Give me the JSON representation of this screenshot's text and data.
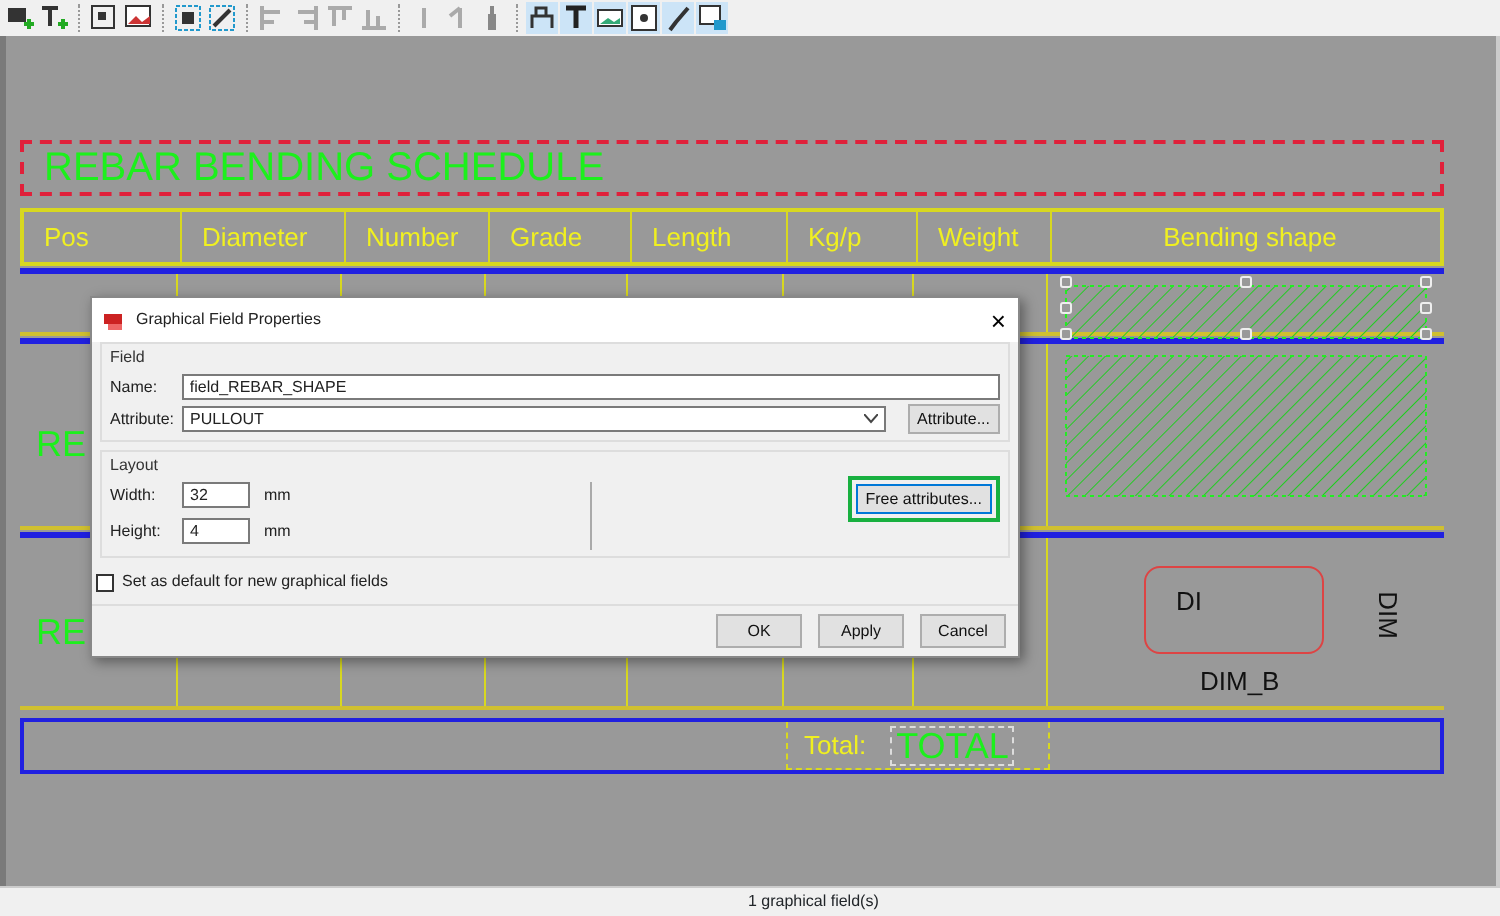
{
  "toolbar": {
    "buttons": [
      {
        "kind": "rect-field",
        "selected": false
      },
      {
        "kind": "text-field",
        "selected": false
      },
      {
        "kind": "frame",
        "selected": false
      },
      {
        "kind": "picture-frame",
        "selected": false
      },
      {
        "kind": "group",
        "selected": false
      },
      {
        "kind": "ungroup",
        "selected": false
      },
      {
        "kind": "align-left",
        "selected": false
      },
      {
        "kind": "align-right",
        "selected": false
      },
      {
        "kind": "align-top",
        "selected": false
      },
      {
        "kind": "align-bottom",
        "selected": false
      },
      {
        "kind": "line",
        "selected": false
      },
      {
        "kind": "angle",
        "selected": false
      },
      {
        "kind": "bottle",
        "selected": false
      },
      {
        "kind": "field",
        "selected": true
      },
      {
        "kind": "text",
        "selected": true
      },
      {
        "kind": "image",
        "selected": true
      },
      {
        "kind": "symbol",
        "selected": true
      },
      {
        "kind": "brush",
        "selected": true
      },
      {
        "kind": "window",
        "selected": true
      }
    ]
  },
  "schedule": {
    "title": "REBAR BENDING SCHEDULE",
    "columns": [
      "Pos",
      "Diameter",
      "Number",
      "Grade",
      "Length",
      "Kg/p",
      "Weight",
      "Bending shape"
    ],
    "rows": [
      {
        "kind": "hatched",
        "first_cell": "",
        "selected": true
      },
      {
        "kind": "hatched",
        "first_cell": "RE",
        "selected": false
      },
      {
        "kind": "dimension",
        "first_cell": "RE",
        "selected": false,
        "labels": [
          "DI",
          "DIM",
          "DIM_B"
        ]
      }
    ],
    "total_label": "Total:",
    "total_value": "TOTAL"
  },
  "dialog": {
    "title": "Graphical Field Properties",
    "close": "×",
    "field_group": "Field",
    "name_label": "Name:",
    "name_value": "field_REBAR_SHAPE",
    "attribute_label": "Attribute:",
    "attribute_value": "PULLOUT",
    "attribute_button": "Attribute...",
    "layout_group": "Layout",
    "width_label": "Width:",
    "width_value": "32",
    "width_unit": "mm",
    "height_label": "Height:",
    "height_value": "4",
    "height_unit": "mm",
    "free_attributes_button": {
      "label": "Free attributes...",
      "focused": true
    },
    "default_checkbox": {
      "label": "Set as default for new graphical fields",
      "checked": false
    },
    "buttons": [
      "OK",
      "Apply",
      "Cancel"
    ]
  },
  "status_bar": {
    "text": "1 graphical field(s)"
  }
}
